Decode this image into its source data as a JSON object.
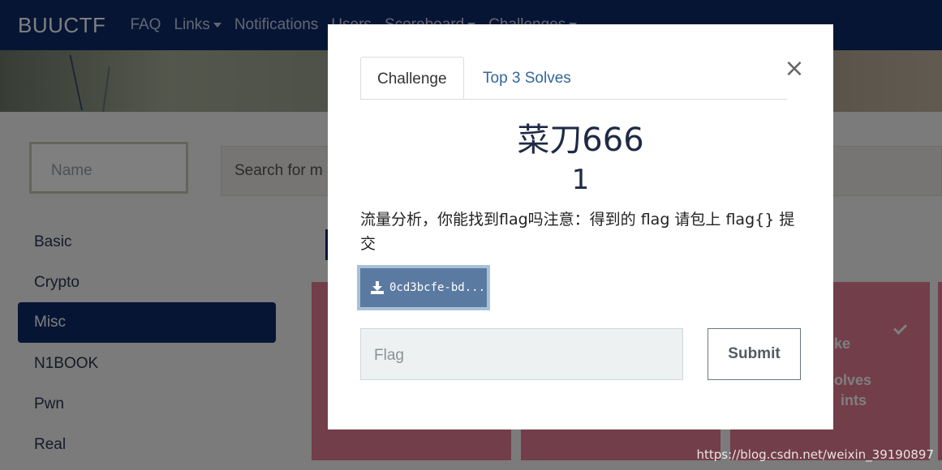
{
  "navbar": {
    "brand": "BUUCTF",
    "items": [
      {
        "label": "FAQ",
        "dropdown": false
      },
      {
        "label": "Links",
        "dropdown": true
      },
      {
        "label": "Notifications",
        "dropdown": false
      },
      {
        "label": "Users",
        "dropdown": false
      },
      {
        "label": "Scoreboard",
        "dropdown": true
      },
      {
        "label": "Challenges",
        "dropdown": true
      }
    ]
  },
  "filters": {
    "name_placeholder": "Name",
    "search_placeholder": "Search for m"
  },
  "categories": [
    {
      "label": "Basic",
      "active": false
    },
    {
      "label": "Crypto",
      "active": false
    },
    {
      "label": "Misc",
      "active": true
    },
    {
      "label": "N1BOOK",
      "active": false
    },
    {
      "label": "Pwn",
      "active": false
    },
    {
      "label": "Real",
      "active": false
    }
  ],
  "card_fragments": {
    "title": "ke",
    "solves": "olves",
    "points": "ints"
  },
  "modal": {
    "tabs": [
      "Challenge",
      "Top 3 Solves"
    ],
    "close": "×",
    "challenge_name": "菜刀666",
    "challenge_value": "1",
    "description": "流量分析，你能找到flag吗注意：得到的 flag 请包上 flag{} 提交",
    "file_label": "0cd3bcfe-bd...",
    "flag_placeholder": "Flag",
    "submit_label": "Submit"
  },
  "watermark": "https://blog.csdn.net/weixin_39190897",
  "colors": {
    "navbar": "#0f2a6b",
    "card": "#e47c93",
    "file_button": "#5b7aa1"
  }
}
